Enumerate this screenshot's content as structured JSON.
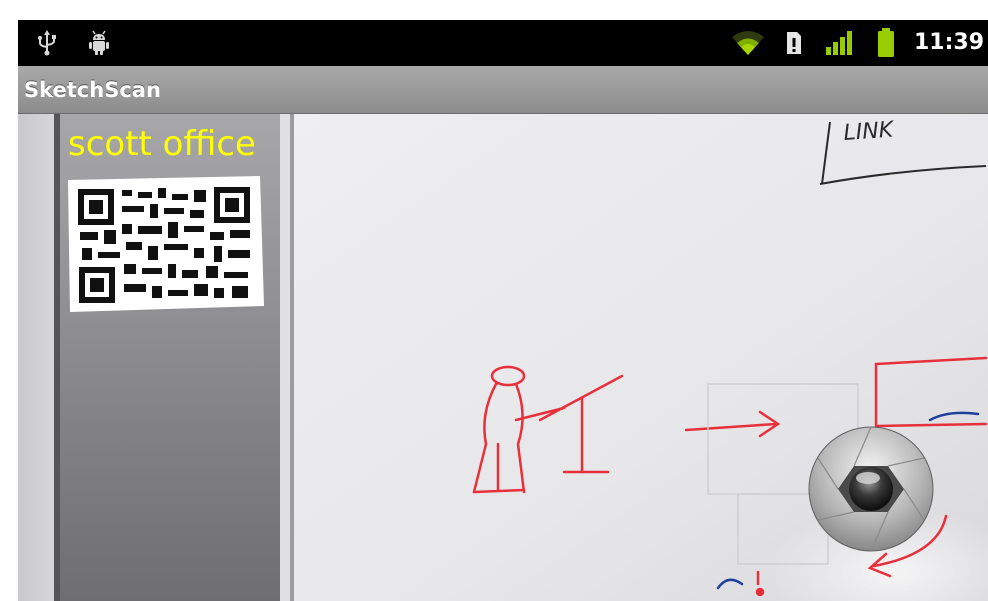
{
  "status_bar": {
    "time": "11:39",
    "icons": [
      "usb-icon",
      "android-debug-icon",
      "wifi-icon",
      "sim-card-icon",
      "signal-strength-icon",
      "battery-icon"
    ],
    "accent_color": "#99cc00"
  },
  "app_bar": {
    "title": "SketchScan"
  },
  "camera": {
    "overlay_label": "scott office",
    "overlay_label_color": "#ffff00",
    "whiteboard_text": "LINK",
    "shutter_button": "shutter-button"
  }
}
